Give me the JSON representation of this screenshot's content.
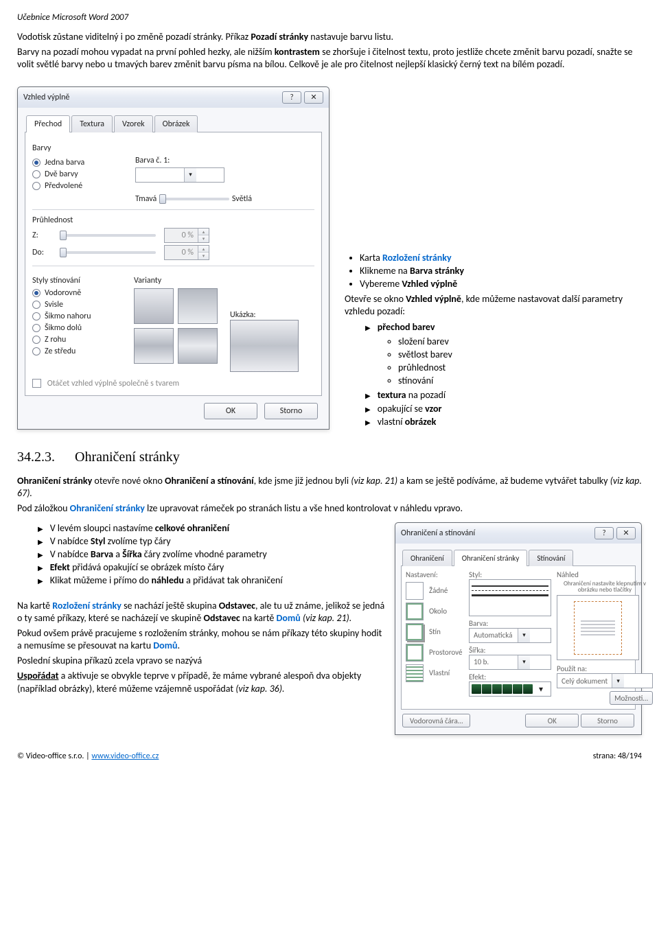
{
  "header": {
    "title": "Učebnice Microsoft Word 2007"
  },
  "intro": {
    "p1_a": "Vodotisk zůstane viditelný i po změně pozadí stránky. Příkaz ",
    "p1_bold": "Pozadí stránky",
    "p1_b": " nastavuje barvu listu.",
    "p2_a": "Barvy na pozadí mohou vypadat na první pohled hezky, ale nižším ",
    "p2_bold": "kontrastem",
    "p2_b": " se zhoršuje i čitelnost textu, proto jestliže chcete změnit barvu pozadí, snažte se volit světlé barvy nebo u tmavých barev změnit barvu písma na bílou. Celkově je ale pro čitelnost nejlepší klasický černý text na bílém pozadí."
  },
  "dialog1": {
    "title": "Vzhled výplně",
    "help": "?",
    "close": "✕",
    "tabs": [
      "Přechod",
      "Textura",
      "Vzorek",
      "Obrázek"
    ],
    "grpBarvy": "Barvy",
    "rJedna": "Jedna barva",
    "rDve": "Dvě barvy",
    "rPred": "Předvolené",
    "lblBarvaC": "Barva č. 1:",
    "lblTma": "Tmavá",
    "lblSvet": "Světlá",
    "grpPruh": "Průhlednost",
    "lblZ": "Z:",
    "lblDo": "Do:",
    "pct": "0 %",
    "grpStyly": "Styly stínování",
    "grpVar": "Varianty",
    "rVod": "Vodorovně",
    "rSvis": "Svisle",
    "rSn": "Šikmo nahoru",
    "rSd": "Šikmo dolů",
    "rRoh": "Z rohu",
    "rStr": "Ze středu",
    "lblUkazka": "Ukázka:",
    "chkOtacet": "Otáčet vzhled výplně společně s tvarem",
    "ok": "OK",
    "storno": "Storno"
  },
  "sidecol": {
    "b1_a": "Karta ",
    "b1_blue": "Rozložení stránky",
    "b2_a": "Klikneme na ",
    "b2_bold": "Barva stránky",
    "b3_a": "Vybereme ",
    "b3_bold": "Vzhled výplně",
    "p_a": "Otevře se okno ",
    "p_bold": "Vzhled výplně",
    "p_b": ", kde můžeme nastavovat další parametry vzhledu pozadí:",
    "t1": "přechod barev",
    "c1": "složení barev",
    "c2": "světlost barev",
    "c3": "průhlednost",
    "c4": "stínování",
    "t2_a": "textura",
    "t2_b": " na pozadí",
    "t3_a": "opakující se ",
    "t3_b": "vzor",
    "t4_a": "vlastní ",
    "t4_b": "obrázek"
  },
  "section": {
    "num": "34.2.3.",
    "title": "Ohraničení stránky"
  },
  "sec2": {
    "p1_a": "Ohraničení stránky",
    "p1_b": " otevře nové okno ",
    "p1_c": "Ohraničení a stínování",
    "p1_d": ", kde jsme již jednou byli ",
    "p1_e": "(viz kap. 21)",
    "p1_f": " a kam se ještě podíváme, až budeme vytvářet tabulky ",
    "p1_g": "(viz kap. 67).",
    "p2_a": "Pod záložkou ",
    "p2_blue": "Ohraničení stránky",
    "p2_b": " lze upravovat rámeček po stranách listu a vše hned kontrolovat v náhledu vpravo.",
    "l1_a": "V levém sloupci nastavíme ",
    "l1_b": "celkové ohraničení",
    "l2_a": "V nabídce ",
    "l2_b": "Styl",
    "l2_c": " zvolíme typ čáry",
    "l3_a": "V nabídce ",
    "l3_b": "Barva",
    "l3_c": " a ",
    "l3_d": "Šířka",
    "l3_e": " čáry zvolíme vhodné parametry",
    "l4_a": "Efekt",
    "l4_b": " přidává opakující se obrázek místo čáry",
    "l5_a": "Klikat můžeme i přímo do ",
    "l5_b": "náhledu",
    "l5_c": " a přidávat tak ohraničení",
    "p3_a": "Na kartě ",
    "p3_blue": "Rozložení stránky",
    "p3_b": " se nachází ještě skupina ",
    "p3_c": "Odstavec",
    "p3_d": ", ale tu už známe, jelikož se jedná o ty samé příkazy, které se nacházejí ve skupině ",
    "p3_e": "Odstavec",
    "p3_f": " na kartě ",
    "p3_g": "Domů",
    "p3_h": " (viz kap. 21).",
    "p4_a": "Pokud ovšem právě pracujeme s rozložením stránky, mohou se nám příkazy této skupiny hodit a nemusíme se přesouvat na kartu ",
    "p4_b": "Domů",
    "p4_c": ".",
    "p5_a": "Poslední skupina příkazů zcela vpravo se nazývá",
    "p5_b": "Uspořádat",
    "p5_c": " a aktivuje se obvykle teprve v případě, že máme vybrané alespoň dva objekty (například obrázky), které můžeme vzájemně uspořádat ",
    "p5_d": "(viz kap. 36)."
  },
  "dialog2": {
    "title": "Ohraničení a stínování",
    "tabs": [
      "Ohraničení",
      "Ohraničení stránky",
      "Stínování"
    ],
    "lblNast": "Nastavení:",
    "lblStyl": "Styl:",
    "lblNahled": "Náhled",
    "tZadne": "Žádné",
    "tOkolo": "Okolo",
    "tStín": "Stín",
    "tProst": "Prostorové",
    "tVlast": "Vlastní",
    "lblBarva": "Barva:",
    "vBarva": "Automatická",
    "lblSirka": "Šířka:",
    "vSirka": "10 b.",
    "lblEfekt": "Efekt:",
    "lblPouzit": "Použít na:",
    "vPouzit": "Celý dokument",
    "hintNahled": "Ohraničení nastavíte klepnutím v obrázku nebo tlačítky",
    "btnMoz": "Možnosti…",
    "btnLine": "Vodorovná čára…",
    "ok": "OK",
    "storno": "Storno"
  },
  "footer": {
    "left_a": "© Video-office s.r.o.  |  ",
    "link": "www.video-office.cz",
    "right": "strana: 48/194"
  }
}
